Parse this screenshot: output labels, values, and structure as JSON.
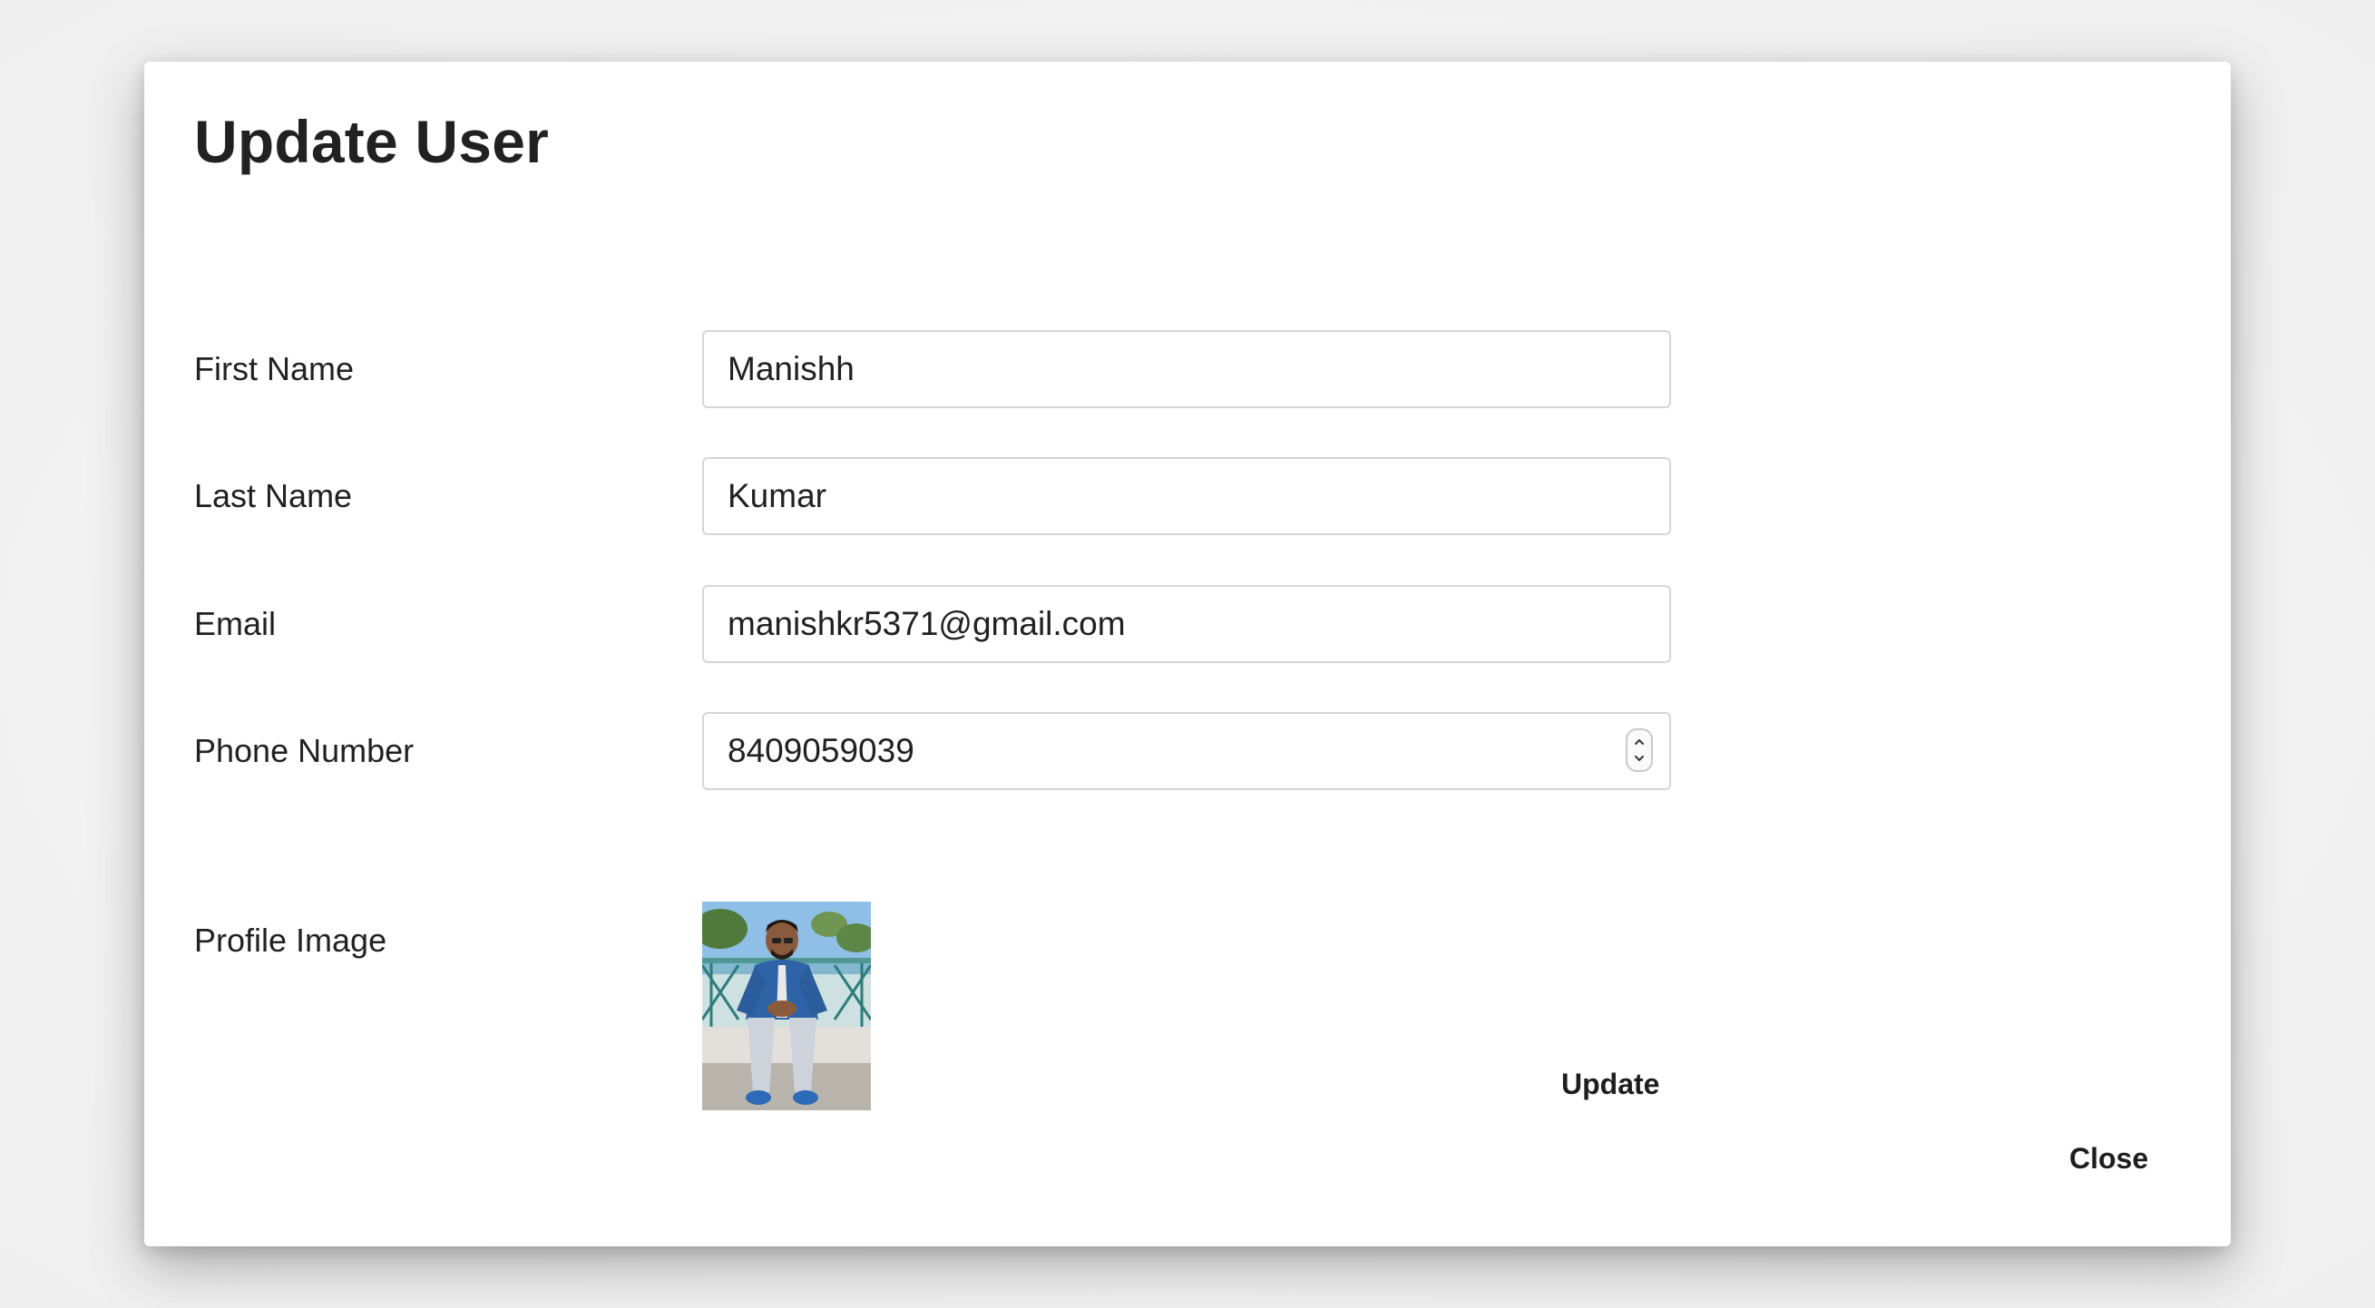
{
  "dialog": {
    "title": "Update User",
    "fields": [
      {
        "label": "First Name",
        "value": "Manishh",
        "type": "text"
      },
      {
        "label": "Last Name",
        "value": "Kumar",
        "type": "text"
      },
      {
        "label": "Email",
        "value": "manishkr5371@gmail.com",
        "type": "email"
      },
      {
        "label": "Phone Number",
        "value": "8409059039",
        "type": "number"
      }
    ],
    "profile_image_label": "Profile Image",
    "update_label": "Update",
    "close_label": "Close"
  },
  "icons": {
    "stepper_up": "chevron-up-icon",
    "stepper_down": "chevron-down-icon"
  }
}
